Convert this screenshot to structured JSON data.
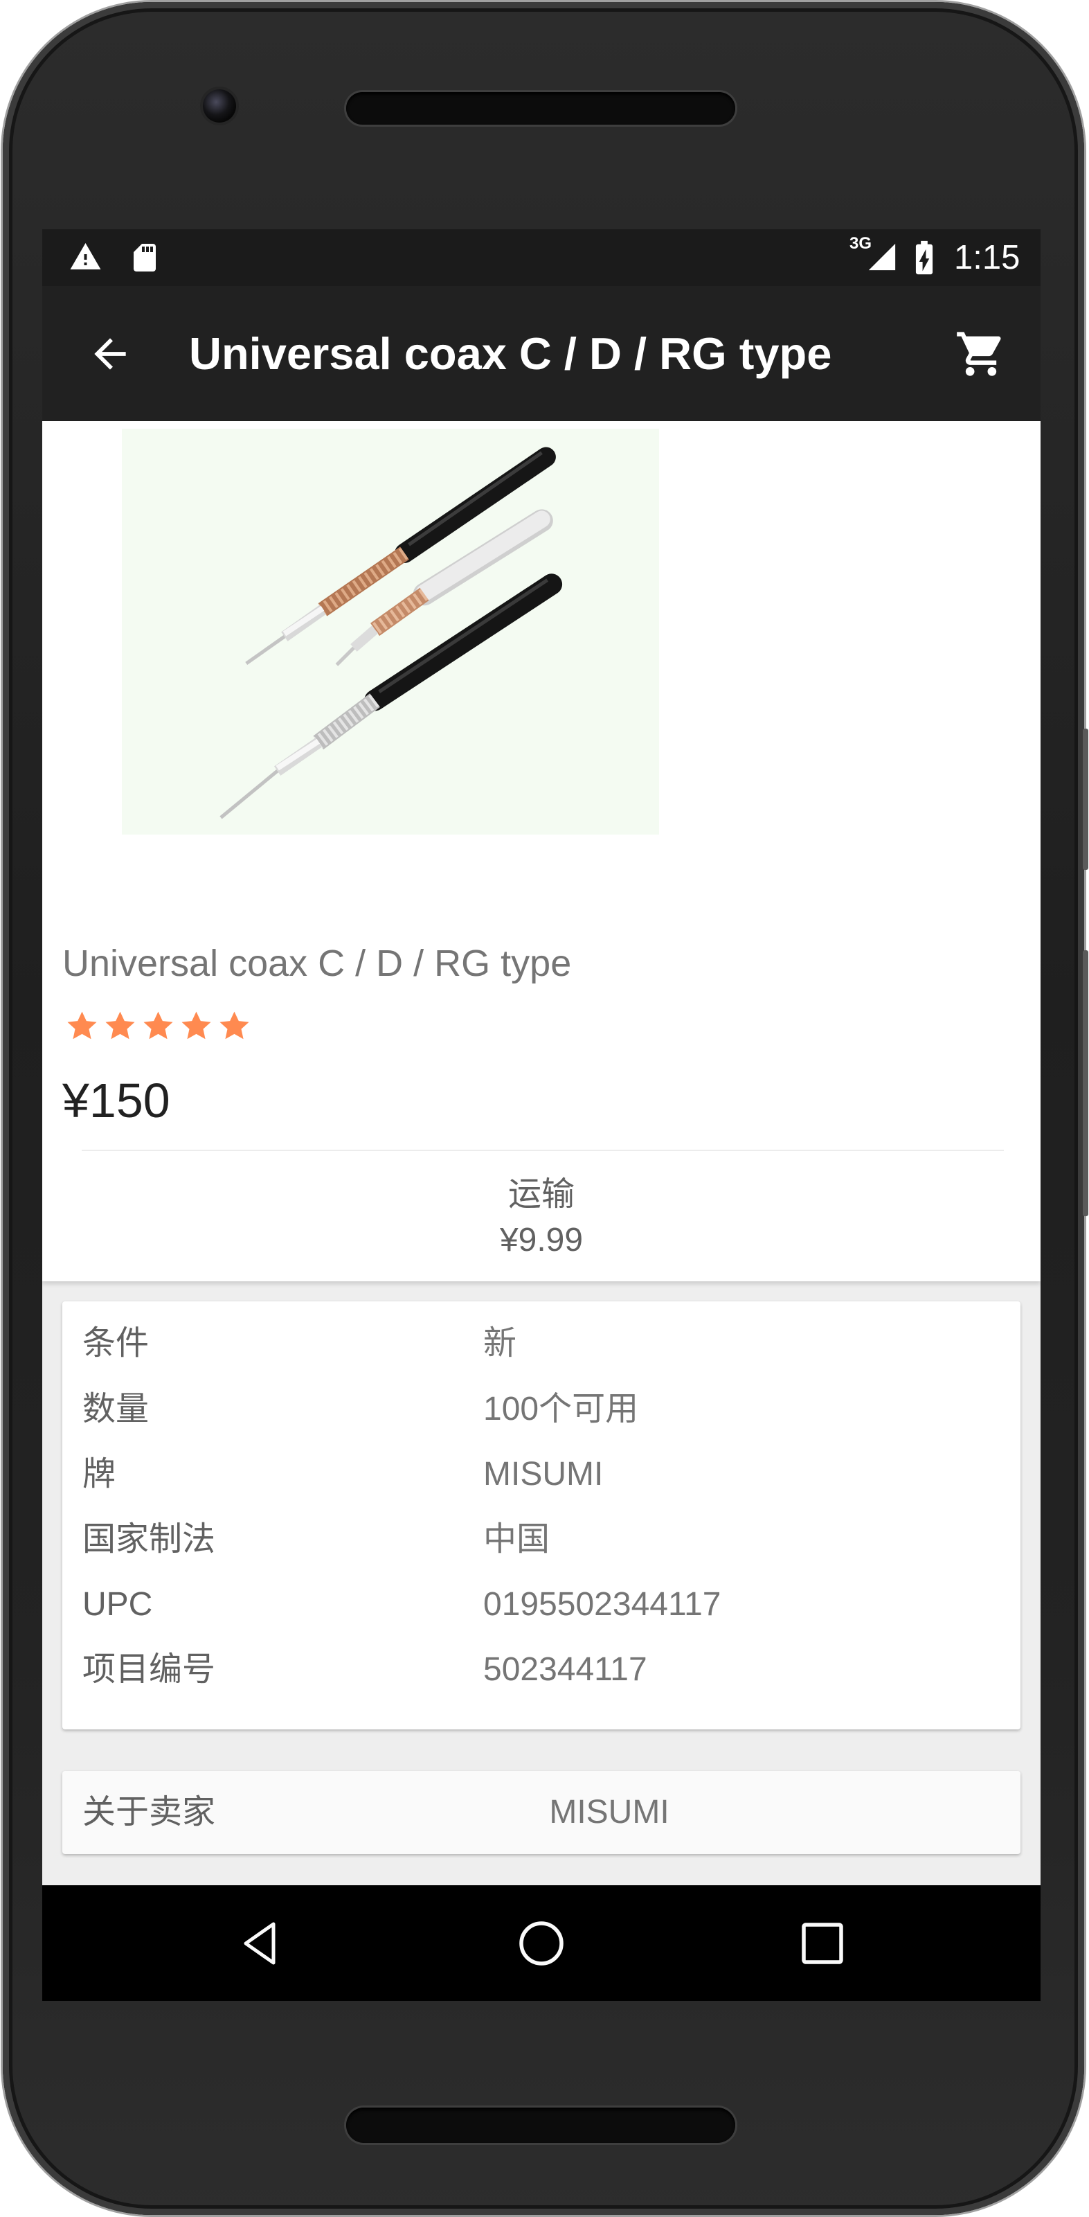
{
  "status_bar": {
    "network": "3G",
    "time": "1:15",
    "left_icons": [
      "warning-icon",
      "sd-card-icon"
    ],
    "right_icons": [
      "signal-icon",
      "battery-charging-icon"
    ]
  },
  "app_bar": {
    "title": "Universal coax C / D / RG type",
    "nav_icon": "arrow-back-icon",
    "action_icon": "shopping-cart-icon"
  },
  "product": {
    "title": "Universal coax C / D / RG type",
    "rating": 5,
    "rating_max": 5,
    "price": "¥150",
    "shipping": {
      "label": "运输",
      "price": "¥9.99"
    }
  },
  "details": [
    {
      "label": "条件",
      "value": "新"
    },
    {
      "label": "数量",
      "value": "100个可用"
    },
    {
      "label": "牌",
      "value": "MISUMI"
    },
    {
      "label": "国家制法",
      "value": "中国"
    },
    {
      "label": "UPC",
      "value": "0195502344117"
    },
    {
      "label": "项目编号",
      "value": "502344117"
    }
  ],
  "seller": {
    "label": "关于卖家",
    "name": "MISUMI"
  },
  "nav_bar": {
    "icons": [
      "back-icon",
      "home-icon",
      "recents-icon"
    ]
  },
  "colors": {
    "status_bar": "#1b1b1b",
    "app_bar": "#212121",
    "star": "#ff8a50",
    "star_empty": "#e0e0e0",
    "page_background": "#eeeeee",
    "nav_bar": "#000000"
  }
}
